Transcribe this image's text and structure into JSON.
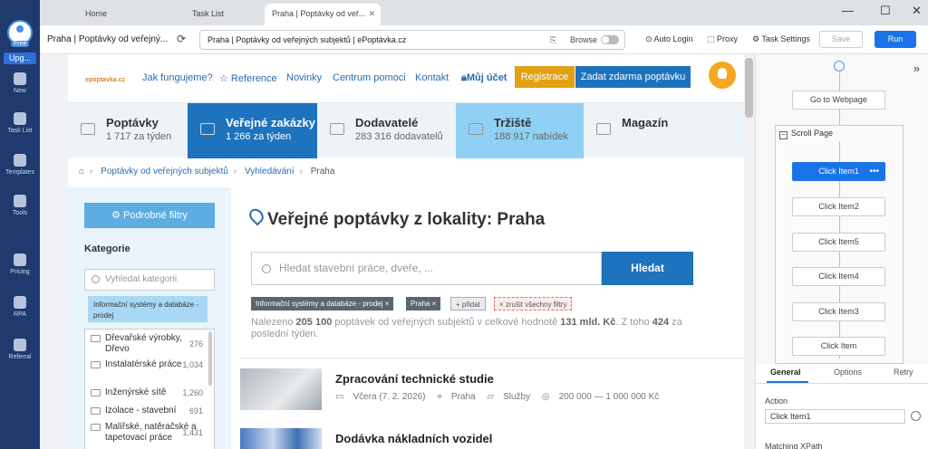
{
  "app": {
    "user_badge": "Free",
    "upgrade_label": "Upg...",
    "sidebar": [
      {
        "label": "New",
        "icon": "plus-icon"
      },
      {
        "label": "Task List",
        "icon": "task-list-icon"
      },
      {
        "label": "Templates",
        "icon": "templates-icon"
      },
      {
        "label": "Tools",
        "icon": "tools-icon"
      },
      {
        "label": "Pricing",
        "icon": "pricing-icon"
      },
      {
        "label": "RPA",
        "icon": "rpa-icon"
      },
      {
        "label": "Referral",
        "icon": "referral-icon"
      }
    ]
  },
  "tabs": [
    {
      "label": "Home"
    },
    {
      "label": "Task List"
    },
    {
      "label": "Praha | Poptávky od veř..."
    }
  ],
  "toolbar": {
    "page_title": "Praha | Poptávky od veřejný...",
    "url": "Praha | Poptávky od veřejných subjektů | ePoptávka.cz",
    "browse_label": "Browse",
    "auto_login": "Auto Login",
    "proxy": "Proxy",
    "task_settings": "Task Settings",
    "save": "Save",
    "run": "Run"
  },
  "site": {
    "logo": "epoptavka.cz",
    "nav": [
      "Jak fungujeme?",
      "☆ Reference",
      "Novinky",
      "Centrum pomoci",
      "Kontakt",
      "Můj účet"
    ],
    "registrace": "Registrace",
    "zadat": "Zadat zdarma poptávku",
    "categories": [
      {
        "title": "Poptávky",
        "sub": "1 717 za týden"
      },
      {
        "title": "Veřejné zakázky",
        "sub": "1 266 za týden"
      },
      {
        "title": "Dodavatelé",
        "sub": "283 316 dodavatelů"
      },
      {
        "title": "Tržiště",
        "sub": "188 917 nabídek"
      },
      {
        "title": "Magazín",
        "sub": ""
      }
    ],
    "breadcrumb": [
      "Poptávky od veřejných subjektů",
      "Vyhledávání",
      "Praha"
    ],
    "filters_button": "Podrobné filtry",
    "kategorie_title": "Kategorie",
    "kategorie_placeholder": "Vyhledat kategorii",
    "kategorie_selected": "Informační systémy a databáze - prodej",
    "kategorie_list": [
      {
        "label": "Dřevařské výrobky, Dřevo",
        "count": "276"
      },
      {
        "label": "Instalatérské práce",
        "count": "1,034"
      },
      {
        "label": "Inženýrské sítě",
        "count": "1,260"
      },
      {
        "label": "Izolace - stavební",
        "count": "691"
      },
      {
        "label": "Malířské, natěračské a tapetovací práce",
        "count": "1,431"
      }
    ],
    "heading": "Veřejné poptávky z lokality: Praha",
    "search_placeholder": "Hledat stavební práce, dveře, ...",
    "search_button": "Hledat",
    "tags": [
      "Informační systémy a databáze - prodej ×",
      "Praha ×",
      "+ přidat",
      "× zrušit všechny filtry"
    ],
    "found_prefix": "Nalezeno ",
    "found_count": "205 100",
    "found_mid": " poptávek od veřejných subjektů v celkové hodnotě ",
    "found_value": "131 mld. Kč",
    "found_mid2": ". Z toho ",
    "found_week": "424",
    "found_suffix": " za poslední týden.",
    "results": [
      {
        "title": "Zpracování technické studie",
        "date": "Včera (7. 2. 2026)",
        "place": "Praha",
        "cat": "Služby",
        "value": "200 000 — 1 000 000 Kč"
      },
      {
        "title": "Dodávka nákladních vozidel",
        "date": "",
        "place": "",
        "cat": "",
        "value": ""
      }
    ]
  },
  "workflow": {
    "nodes": [
      "Go to Webpage",
      "Click Item1",
      "Click Item2",
      "Click Item5",
      "Click Item4",
      "Click Item3",
      "Click Item"
    ],
    "loop_label": "Scroll Page",
    "panel_tabs": [
      "General",
      "Options",
      "Retry"
    ],
    "action_label": "Action",
    "action_value": "Click Item1",
    "xpath_label": "Matching XPath"
  }
}
